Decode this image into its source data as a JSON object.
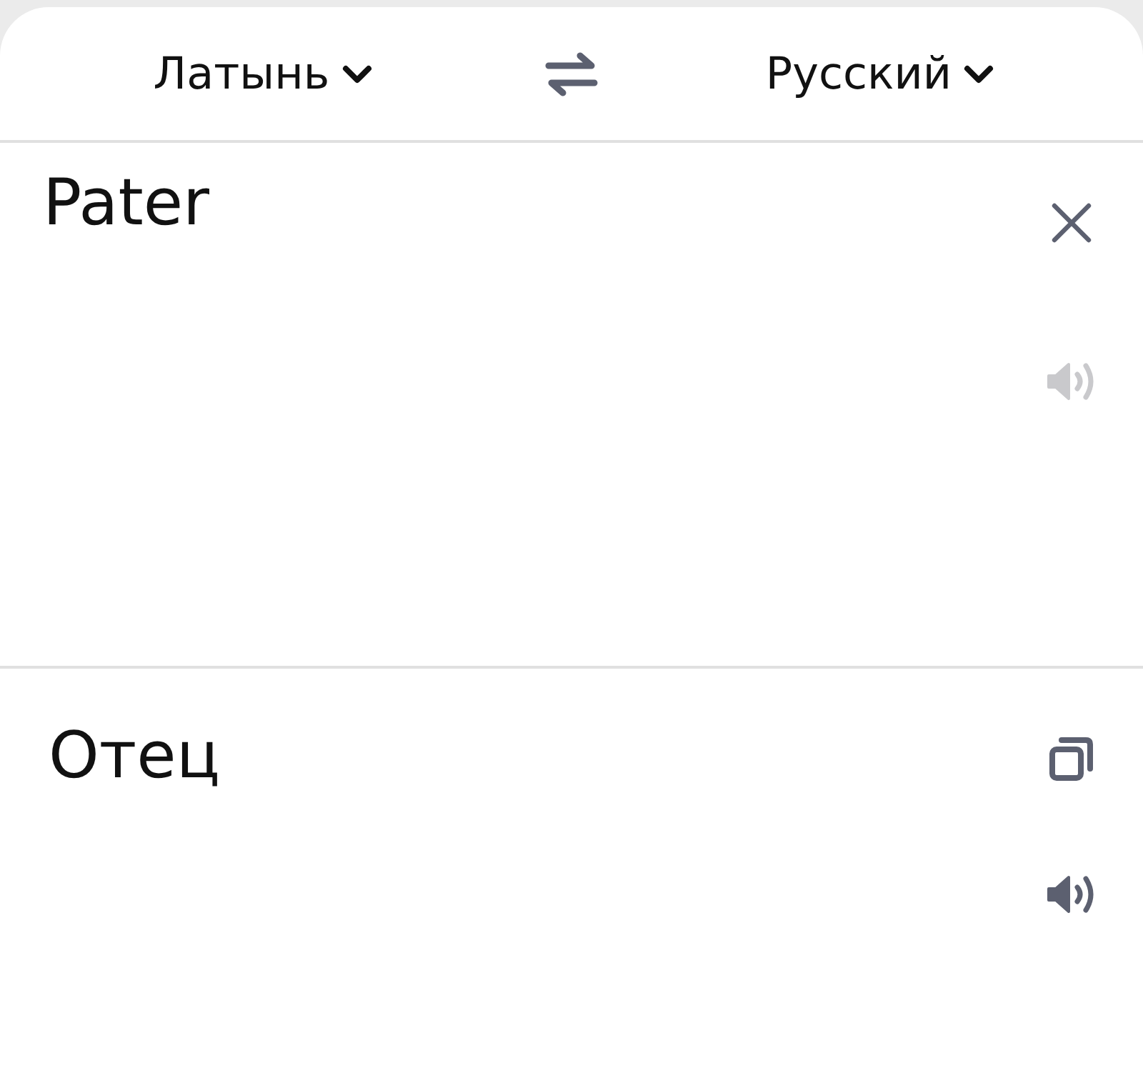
{
  "header": {
    "source_language": {
      "label": "Латынь"
    },
    "target_language": {
      "label": "Русский"
    }
  },
  "source": {
    "text": "Pater",
    "speaker_disabled": true
  },
  "translation": {
    "text": "Отец",
    "speaker_disabled": false
  }
}
